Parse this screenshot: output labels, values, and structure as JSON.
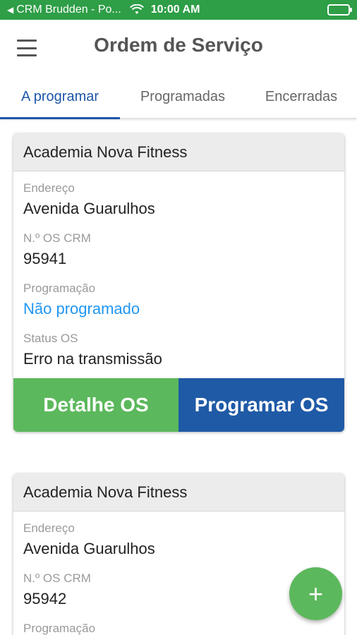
{
  "status_bar": {
    "back_arrow": "◀",
    "carrier": "CRM Brudden - Po...",
    "time": "10:00 AM",
    "wifi_icon": "wifi-icon",
    "battery_icon": "battery-icon"
  },
  "app_bar": {
    "title": "Ordem de Serviço",
    "menu_icon": "hamburger-menu-icon"
  },
  "tabs": [
    {
      "label": "A programar",
      "active": true
    },
    {
      "label": "Programadas",
      "active": false
    },
    {
      "label": "Encerradas",
      "active": false
    }
  ],
  "cards": [
    {
      "title": "Academia Nova Fitness",
      "fields": [
        {
          "label": "Endereço",
          "value": "Avenida Guarulhos"
        },
        {
          "label": "N.º OS CRM",
          "value": "95941"
        },
        {
          "label": "Programação",
          "value": "Não programado"
        },
        {
          "label": "Status OS",
          "value": "Erro na transmissão"
        }
      ],
      "actions": {
        "detail": "Detalhe OS",
        "program": "Programar OS"
      }
    },
    {
      "title": "Academia Nova Fitness",
      "fields": [
        {
          "label": "Endereço",
          "value": "Avenida Guarulhos"
        },
        {
          "label": "N.º OS CRM",
          "value": "95942"
        },
        {
          "label": "Programação",
          "value": ""
        }
      ]
    }
  ],
  "fab": {
    "label": "+",
    "icon": "plus-icon"
  },
  "colors": {
    "status_bar": "#2e9e47",
    "primary_blue": "#1f5aa6",
    "success_green": "#5cb85c",
    "link_blue": "#2196f3"
  }
}
